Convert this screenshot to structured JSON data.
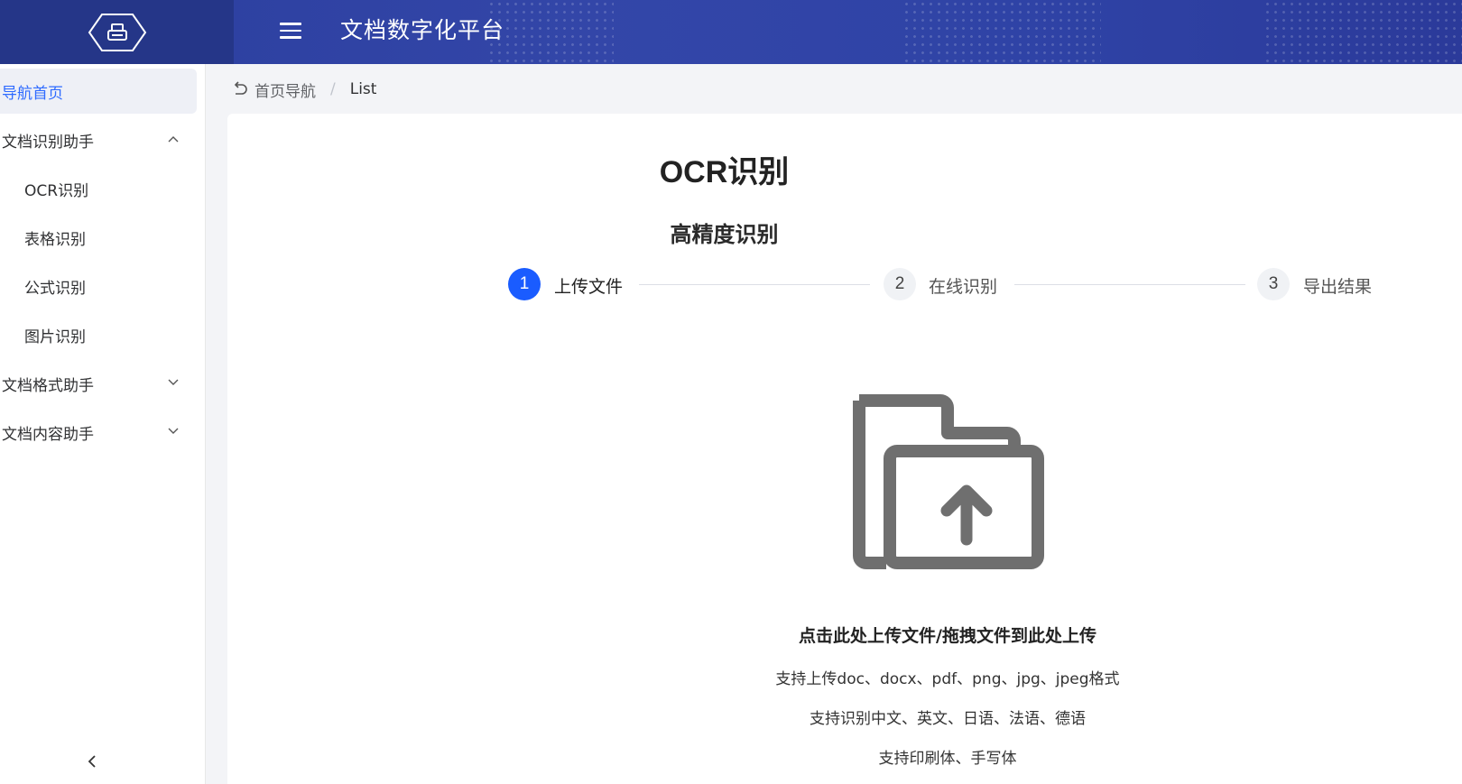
{
  "app": {
    "title": "文档数字化平台",
    "logo_icon": "printer-icon",
    "menu_icon": "hamburger-menu-icon"
  },
  "sidebar": {
    "items": [
      {
        "label": "导航首页",
        "type": "item",
        "active": true
      },
      {
        "label": "文档识别助手",
        "type": "group",
        "expanded": true
      },
      {
        "label": "OCR识别",
        "type": "sub"
      },
      {
        "label": "表格识别",
        "type": "sub"
      },
      {
        "label": "公式识别",
        "type": "sub"
      },
      {
        "label": "图片识别",
        "type": "sub"
      },
      {
        "label": "文档格式助手",
        "type": "group",
        "expanded": false
      },
      {
        "label": "文档内容助手",
        "type": "group",
        "expanded": false
      }
    ],
    "collapse_icon": "chevron-left-icon"
  },
  "breadcrumb": {
    "back_icon": "undo-arrow-icon",
    "home": "首页导航",
    "separator": "/",
    "current": "List"
  },
  "page": {
    "title": "OCR识别",
    "subtitle": "高精度识别"
  },
  "steps": [
    {
      "number": "1",
      "label": "上传文件",
      "active": true
    },
    {
      "number": "2",
      "label": "在线识别",
      "active": false
    },
    {
      "number": "3",
      "label": "导出结果",
      "active": false
    }
  ],
  "upload": {
    "icon": "folder-upload-icon",
    "main_text": "点击此处上传文件/拖拽文件到此处上传",
    "notes": [
      "支持上传doc、docx、pdf、png、jpg、jpeg格式",
      "支持识别中文、英文、日语、法语、德语",
      "支持印刷体、手写体"
    ]
  },
  "colors": {
    "header_bg": "#3346a8",
    "logo_bg": "#253688",
    "accent": "#1a5cff",
    "active_nav_text": "#2f6bff"
  }
}
